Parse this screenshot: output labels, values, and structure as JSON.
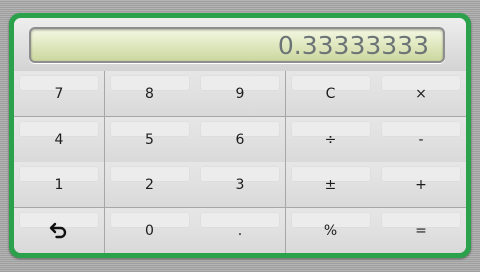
{
  "app": {
    "frame_color": "#2aa14a"
  },
  "display": {
    "value": "0.33333333"
  },
  "keys": [
    [
      {
        "label": "7",
        "name": "key-7"
      },
      {
        "label": "8",
        "name": "key-8"
      },
      {
        "label": "9",
        "name": "key-9"
      },
      {
        "label": "C",
        "name": "clear-button"
      },
      {
        "label": "×",
        "name": "multiply-button"
      }
    ],
    [
      {
        "label": "4",
        "name": "key-4"
      },
      {
        "label": "5",
        "name": "key-5"
      },
      {
        "label": "6",
        "name": "key-6"
      },
      {
        "label": "÷",
        "name": "divide-button"
      },
      {
        "label": "-",
        "name": "subtract-button"
      }
    ],
    [
      {
        "label": "1",
        "name": "key-1"
      },
      {
        "label": "2",
        "name": "key-2"
      },
      {
        "label": "3",
        "name": "key-3"
      },
      {
        "label": "±",
        "name": "sign-toggle-button"
      },
      {
        "label": "+",
        "name": "add-button"
      }
    ],
    [
      {
        "icon": "back-arrow-icon",
        "name": "back-button"
      },
      {
        "label": "0",
        "name": "key-0"
      },
      {
        "label": ".",
        "name": "decimal-point-button"
      },
      {
        "label": "%",
        "name": "percent-button"
      },
      {
        "label": "=",
        "name": "equals-button"
      }
    ]
  ]
}
